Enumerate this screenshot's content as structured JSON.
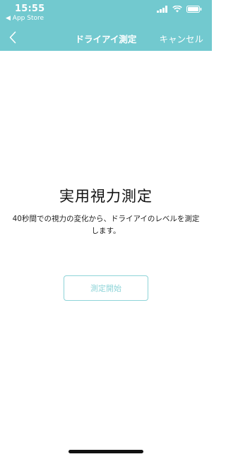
{
  "status_bar": {
    "time": "15:55",
    "back_app_label": "◀ App Store",
    "icons": [
      "signal-icon",
      "wifi-icon",
      "battery-icon"
    ]
  },
  "nav": {
    "title": "ドライアイ測定",
    "cancel_label": "キャンセル",
    "back_icon": "chevron-left-icon"
  },
  "main": {
    "title": "実用視力測定",
    "description": "40秒間での視力の変化から、ドライアイのレベルを測定します。",
    "start_button_label": "測定開始"
  },
  "colors": {
    "header_bg": "#72c9cf",
    "button_accent": "#8ed4d8"
  }
}
